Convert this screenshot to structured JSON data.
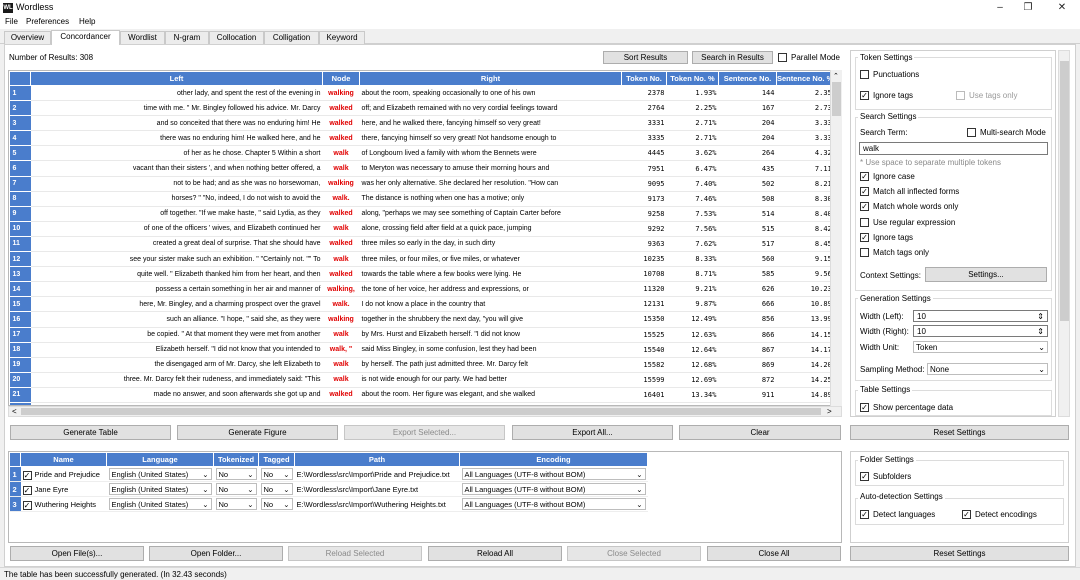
{
  "window": {
    "title": "Wordless",
    "logo": "WL",
    "min_icon": "minimize-icon",
    "max_icon": "maximize-icon",
    "close_icon": "close-icon"
  },
  "menu": [
    "File",
    "Preferences",
    "Help"
  ],
  "tabs": [
    "Overview",
    "Concordancer",
    "Wordlist",
    "N-gram",
    "Collocation",
    "Colligation",
    "Keyword"
  ],
  "active_tab": "Concordancer",
  "results": {
    "label": "Number of Results: 308"
  },
  "top_buttons": {
    "sort": "Sort Results",
    "search": "Search in Results",
    "parallel": "Parallel Mode"
  },
  "table": {
    "headers": [
      "Left",
      "Node",
      "Right",
      "Token No.",
      "Token No. %",
      "Sentence No.",
      "Sentence No. %"
    ],
    "rows": [
      [
        "1",
        "other lady, and spent the rest of the evening in",
        "walking",
        "about the room, speaking occasionally to one of his own",
        "2378",
        "1.93%",
        "144",
        "2.35"
      ],
      [
        "2",
        "time with me. \" Mr. Bingley followed his advice. Mr. Darcy",
        "walked",
        "off; and Elizabeth remained with no very cordial feelings toward",
        "2764",
        "2.25%",
        "167",
        "2.73"
      ],
      [
        "3",
        "and so conceited that there was no enduring him! He",
        "walked",
        "here, and he walked there, fancying himself so very great!",
        "3331",
        "2.71%",
        "204",
        "3.33"
      ],
      [
        "4",
        "there was no enduring him! He walked here, and he",
        "walked",
        "there, fancying himself so very great! Not handsome enough to",
        "3335",
        "2.71%",
        "204",
        "3.33"
      ],
      [
        "5",
        "of her as he chose. Chapter 5 Within a short",
        "walk",
        "of Longbourn lived a family with whom the Bennets were",
        "4445",
        "3.62%",
        "264",
        "4.32"
      ],
      [
        "6",
        "vacant than their sisters ', and when nothing better offered, a",
        "walk",
        "to Meryton was necessary to amuse their morning hours and",
        "7951",
        "6.47%",
        "435",
        "7.11"
      ],
      [
        "7",
        "not to be had; and as she was no horsewoman,",
        "walking",
        "was her only alternative. She declared her resolution. \"How can",
        "9095",
        "7.40%",
        "502",
        "8.21"
      ],
      [
        "8",
        "horses? \" \"No, indeed, I do not wish to avoid the",
        "walk.",
        "The distance is nothing when one has a motive; only",
        "9173",
        "7.46%",
        "508",
        "8.30"
      ],
      [
        "9",
        "off together. \"If we make haste, \" said Lydia, as they",
        "walked",
        "along, \"perhaps we may see something of Captain Carter before",
        "9258",
        "7.53%",
        "514",
        "8.40"
      ],
      [
        "10",
        "of one of the officers ' wives, and Elizabeth continued her",
        "walk",
        "alone, crossing field after field at a quick pace, jumping",
        "9292",
        "7.56%",
        "515",
        "8.42"
      ],
      [
        "11",
        "created a great deal of surprise. That she should have",
        "walked",
        "three miles so early in the day, in such dirty",
        "9363",
        "7.62%",
        "517",
        "8.45"
      ],
      [
        "12",
        "see your sister make such an exhibition. \" \"Certainly not. \"\" To",
        "walk",
        "three miles, or four miles, or five miles, or whatever",
        "10235",
        "8.33%",
        "560",
        "9.15"
      ],
      [
        "13",
        "quite well. \" Elizabeth thanked him from her heart, and then",
        "walked",
        "towards the table where a few books were lying. He",
        "10708",
        "8.71%",
        "585",
        "9.56"
      ],
      [
        "14",
        "possess a certain something in her air and manner of",
        "walking,",
        "the tone of her voice, her address and expressions, or",
        "11320",
        "9.21%",
        "626",
        "10.23"
      ],
      [
        "15",
        "here, Mr. Bingley, and a charming prospect over the gravel",
        "walk.",
        "I do not know a place in the country that",
        "12131",
        "9.87%",
        "666",
        "10.89"
      ],
      [
        "16",
        "such an alliance. \"I hope, \" said she, as they were",
        "walking",
        "together in the shrubbery the next day, \"you will give",
        "15350",
        "12.49%",
        "856",
        "13.99"
      ],
      [
        "17",
        "be copied. \" At that moment they were met from another",
        "walk",
        "by Mrs. Hurst and Elizabeth herself. \"I did not know",
        "15525",
        "12.63%",
        "866",
        "14.15"
      ],
      [
        "18",
        "Elizabeth herself. \"I did not know that you intended to",
        "walk, \"",
        "said Miss Bingley, in some confusion, lest they had been",
        "15540",
        "12.64%",
        "867",
        "14.17"
      ],
      [
        "19",
        "the disengaged arm of Mr. Darcy, she left Elizabeth to",
        "walk",
        "by herself. The path just admitted three. Mr. Darcy felt",
        "15582",
        "12.68%",
        "869",
        "14.20"
      ],
      [
        "20",
        "three. Mr. Darcy felt their rudeness, and immediately said: \"This",
        "walk",
        "is not wide enough for our party. We had better",
        "15599",
        "12.69%",
        "872",
        "14.25"
      ],
      [
        "21",
        "made no answer, and soon afterwards she got up and",
        "walked",
        "about the room. Her figure was elegant, and she walked",
        "16401",
        "13.34%",
        "911",
        "14.89"
      ],
      [
        "22",
        "walked about the room. Her figure was elegant, and she",
        "walked",
        "well; but Darcy, at whom it was all aimed, was",
        "16411",
        "13.35%",
        "912",
        "14.91"
      ]
    ]
  },
  "table_buttons": [
    "Generate Table",
    "Generate Figure",
    "Export Selected...",
    "Export All...",
    "Clear"
  ],
  "files": {
    "headers": [
      "Name",
      "Language",
      "Tokenized",
      "Tagged",
      "Path",
      "Encoding"
    ],
    "rows": [
      [
        "1",
        "Pride and Prejudice",
        "English (United States)",
        "No",
        "No",
        "E:\\Wordless\\src\\Import\\Pride and Prejudice.txt",
        "All Languages (UTF-8 without BOM)"
      ],
      [
        "2",
        "Jane Eyre",
        "English (United States)",
        "No",
        "No",
        "E:\\Wordless\\src\\Import\\Jane Eyre.txt",
        "All Languages (UTF-8 without BOM)"
      ],
      [
        "3",
        "Wuthering Heights",
        "English (United States)",
        "No",
        "No",
        "E:\\Wordless\\src\\Import\\Wuthering Heights.txt",
        "All Languages (UTF-8 without BOM)"
      ]
    ]
  },
  "file_buttons": [
    "Open File(s)...",
    "Open Folder...",
    "Reload Selected",
    "Reload All",
    "Close Selected",
    "Close All"
  ],
  "settings": {
    "token_settings": {
      "title": "Token Settings",
      "punctuations": "Punctuations",
      "ignore_tags": "Ignore tags",
      "use_tags_only": "Use tags only"
    },
    "search_settings": {
      "title": "Search Settings",
      "term_label": "Search Term:",
      "multi_search": "Multi-search Mode",
      "term_value": "walk",
      "hint": "* Use space to separate multiple tokens",
      "ignore_case": "Ignore case",
      "match_inflected": "Match all inflected forms",
      "match_whole": "Match whole words only",
      "regex": "Use regular expression",
      "ignore_tags": "Ignore tags",
      "match_tags": "Match tags only",
      "context_label": "Context Settings:",
      "context_btn": "Settings..."
    },
    "generation_settings": {
      "title": "Generation Settings",
      "width_left_label": "Width (Left):",
      "width_left": "10",
      "width_right_label": "Width (Right):",
      "width_right": "10",
      "width_unit_label": "Width Unit:",
      "width_unit": "Token",
      "sampling_label": "Sampling Method:",
      "sampling": "None"
    },
    "table_settings": {
      "title": "Table Settings",
      "show_pct": "Show percentage data"
    },
    "reset": "Reset Settings"
  },
  "folder_settings": {
    "title": "Folder Settings",
    "subfolders": "Subfolders",
    "auto_title": "Auto-detection Settings",
    "detect_lang": "Detect languages",
    "detect_enc": "Detect encodings",
    "reset": "Reset Settings"
  },
  "status": "The table has been successfully generated. (In 32.43 seconds)",
  "colors": {
    "header_blue": "#4a7dcc",
    "node_red": "#e00000"
  }
}
